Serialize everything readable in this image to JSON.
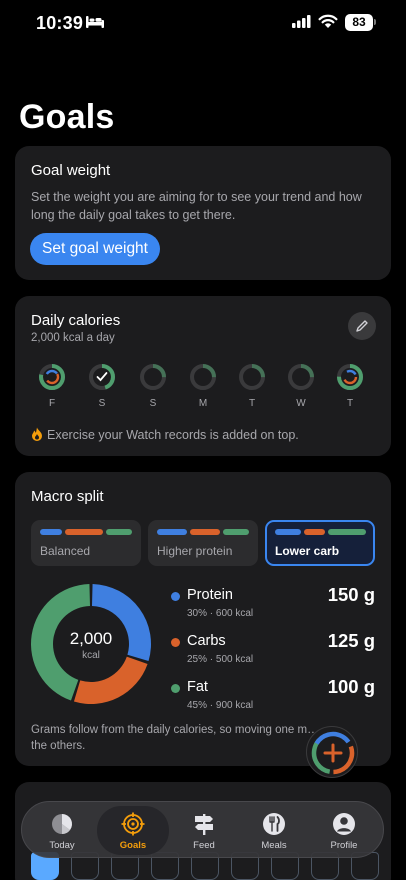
{
  "status_bar": {
    "time": "10:39",
    "battery": "83"
  },
  "page": {
    "title": "Goals"
  },
  "goal_weight": {
    "title": "Goal weight",
    "description": "Set the weight you are aiming for to see your trend and how long the daily goal takes to get there.",
    "button_label": "Set goal weight"
  },
  "daily_calories": {
    "title": "Daily calories",
    "subtitle": "2,000 kcal a day",
    "days": [
      {
        "label": "F",
        "progress": 0.78,
        "checked": false
      },
      {
        "label": "S",
        "progress": 0.45,
        "checked": true
      },
      {
        "label": "S",
        "progress": 0.25,
        "checked": false
      },
      {
        "label": "M",
        "progress": 0.25,
        "checked": false
      },
      {
        "label": "T",
        "progress": 0.25,
        "checked": false
      },
      {
        "label": "W",
        "progress": 0.25,
        "checked": false
      },
      {
        "label": "T",
        "progress": 0.75,
        "checked": false
      }
    ],
    "note": "Exercise your Watch records is added on top."
  },
  "macro_split": {
    "title": "Macro split",
    "presets": [
      {
        "label": "Balanced",
        "selected": false
      },
      {
        "label": "Higher protein",
        "selected": false
      },
      {
        "label": "Lower carb",
        "selected": true
      }
    ],
    "total_value": "2,000",
    "total_unit": "kcal",
    "macros": [
      {
        "name": "Protein",
        "detail": "30% · 600 kcal",
        "grams": "150 g",
        "share": 0.3,
        "color": "#3f7fe0"
      },
      {
        "name": "Carbs",
        "detail": "25% · 500 kcal",
        "grams": "125 g",
        "share": 0.25,
        "color": "#d9622b"
      },
      {
        "name": "Fat",
        "detail": "45% · 900 kcal",
        "grams": "100 g",
        "share": 0.45,
        "color": "#4f9e6e"
      }
    ],
    "footnote": "Grams follow from the daily calories, so moving one m… the others."
  },
  "tab_bar": {
    "tabs": [
      {
        "label": "Today",
        "icon": "today-ring-icon",
        "active": false
      },
      {
        "label": "Goals",
        "icon": "target-icon",
        "active": true
      },
      {
        "label": "Feed",
        "icon": "signpost-icon",
        "active": false
      },
      {
        "label": "Meals",
        "icon": "fork-knife-icon",
        "active": false
      },
      {
        "label": "Profile",
        "icon": "person-icon",
        "active": false
      }
    ]
  },
  "colors": {
    "accent": "#3a86f0",
    "protein": "#3f7fe0",
    "carbs": "#d9622b",
    "fat": "#4f9e6e",
    "active_tab": "#f59e0b"
  }
}
